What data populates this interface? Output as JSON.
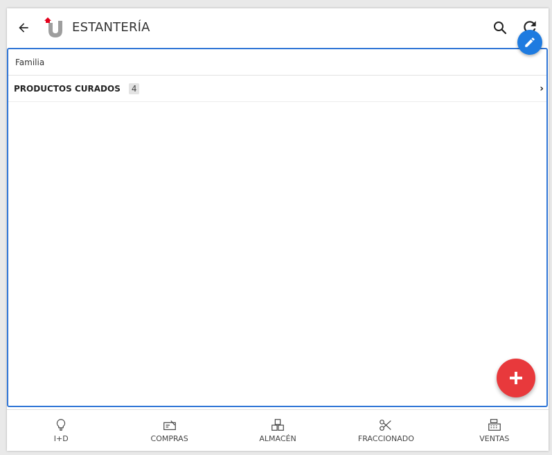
{
  "header": {
    "title": "ESTANTERÍA",
    "icons": [
      "back-arrow-icon",
      "app-logo",
      "search-icon",
      "refresh-icon",
      "pencil-icon"
    ]
  },
  "table": {
    "column_header": "Familia",
    "rows": [
      {
        "label": "PRODUCTOS CURADOS",
        "count": "4"
      }
    ]
  },
  "fab": {
    "icon": "plus-icon",
    "color": "#e8393c"
  },
  "edit_fab": {
    "icon": "pencil-icon",
    "color": "#1e7be0"
  },
  "bottom_nav": {
    "items": [
      {
        "label": "I+D",
        "icon": "lightbulb-icon"
      },
      {
        "label": "COMPRAS",
        "icon": "purchase-icon"
      },
      {
        "label": "ALMACÉN",
        "icon": "boxes-icon"
      },
      {
        "label": "FRACCIONADO",
        "icon": "scissors-icon"
      },
      {
        "label": "VENTAS",
        "icon": "cash-register-icon"
      }
    ]
  },
  "colors": {
    "accent": "#2f75d6",
    "logo_red": "#e3001b",
    "logo_gray": "#9e9e9e"
  }
}
